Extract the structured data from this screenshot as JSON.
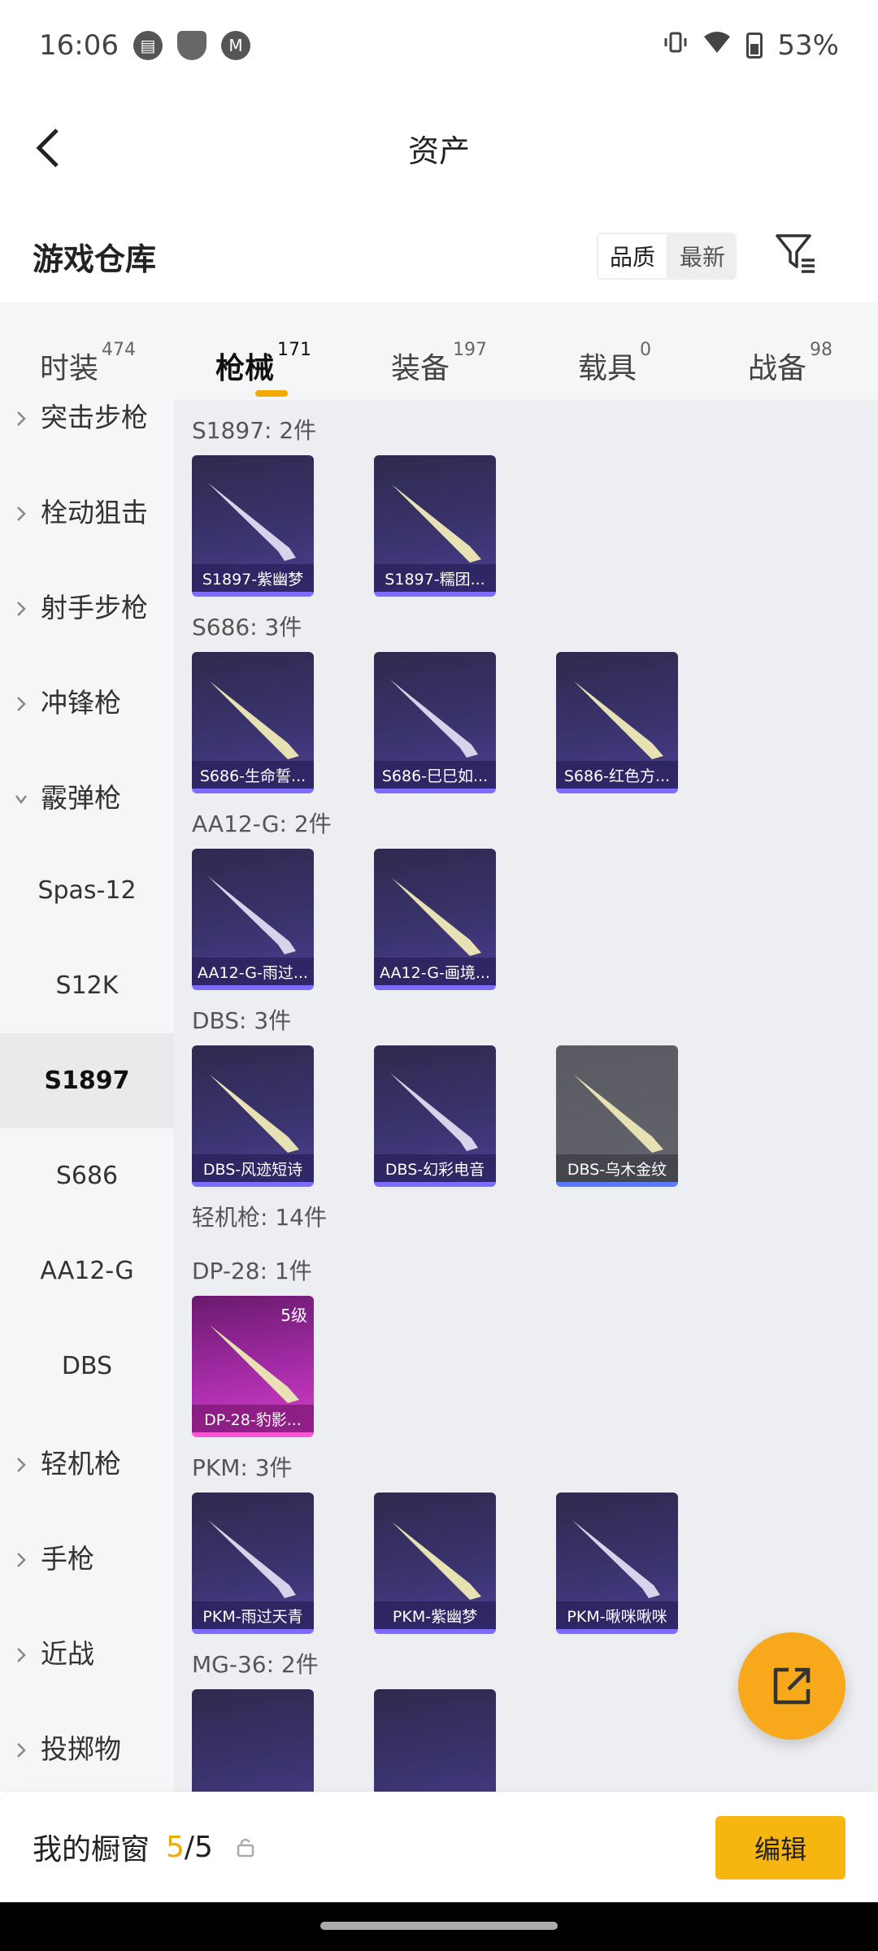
{
  "status_bar": {
    "time": "16:06",
    "battery": "53%"
  },
  "header": {
    "title": "资产"
  },
  "warehouse": {
    "title": "游戏仓库",
    "sort_options": [
      "品质",
      "最新"
    ],
    "active_sort": "品质"
  },
  "tabs": [
    {
      "label": "时装",
      "count": "474"
    },
    {
      "label": "枪械",
      "count": "171",
      "active": true
    },
    {
      "label": "装备",
      "count": "197"
    },
    {
      "label": "载具",
      "count": "0"
    },
    {
      "label": "战备",
      "count": "98"
    }
  ],
  "sidebar": {
    "items": [
      {
        "label": "突击步枪",
        "type": "category",
        "expanded": false
      },
      {
        "label": "栓动狙击",
        "type": "category",
        "expanded": false
      },
      {
        "label": "射手步枪",
        "type": "category",
        "expanded": false
      },
      {
        "label": "冲锋枪",
        "type": "category",
        "expanded": false
      },
      {
        "label": "霰弹枪",
        "type": "category",
        "expanded": true
      },
      {
        "label": "Spas-12",
        "type": "sub"
      },
      {
        "label": "S12K",
        "type": "sub"
      },
      {
        "label": "S1897",
        "type": "sub",
        "selected": true
      },
      {
        "label": "S686",
        "type": "sub"
      },
      {
        "label": "AA12-G",
        "type": "sub"
      },
      {
        "label": "DBS",
        "type": "sub"
      },
      {
        "label": "轻机枪",
        "type": "category",
        "expanded": false
      },
      {
        "label": "手枪",
        "type": "category",
        "expanded": false
      },
      {
        "label": "近战",
        "type": "category",
        "expanded": false
      },
      {
        "label": "投掷物",
        "type": "category",
        "expanded": false
      }
    ]
  },
  "groups": [
    {
      "title": "S1897: 2件",
      "items": [
        {
          "name": "S1897-紫幽梦"
        },
        {
          "name": "S1897-糯团..."
        }
      ]
    },
    {
      "title": "S686: 3件",
      "items": [
        {
          "name": "S686-生命誓..."
        },
        {
          "name": "S686-巳巳如..."
        },
        {
          "name": "S686-红色方..."
        }
      ]
    },
    {
      "title": "AA12-G: 2件",
      "items": [
        {
          "name": "AA12-G-雨过..."
        },
        {
          "name": "AA12-G-画境..."
        }
      ]
    },
    {
      "title": "DBS: 3件",
      "items": [
        {
          "name": "DBS-风迹短诗"
        },
        {
          "name": "DBS-幻彩电音"
        },
        {
          "name": "DBS-乌木金纹",
          "rarity": "gray"
        }
      ]
    },
    {
      "title": "轻机枪: 14件",
      "items": []
    },
    {
      "title": "DP-28: 1件",
      "items": [
        {
          "name": "DP-28-豹影...",
          "rarity": "pink",
          "level": "5级"
        }
      ]
    },
    {
      "title": "PKM: 3件",
      "items": [
        {
          "name": "PKM-雨过天青"
        },
        {
          "name": "PKM-紫幽梦"
        },
        {
          "name": "PKM-啾咪啾咪"
        }
      ]
    },
    {
      "title": "MG-36: 2件",
      "items": []
    }
  ],
  "bottom_bar": {
    "label": "我的橱窗",
    "count": "5",
    "total": "/5",
    "edit_label": "编辑"
  },
  "colors": {
    "accent": "#f5a800",
    "fab": "#f7a91b",
    "edit_button": "#f7b60f"
  }
}
